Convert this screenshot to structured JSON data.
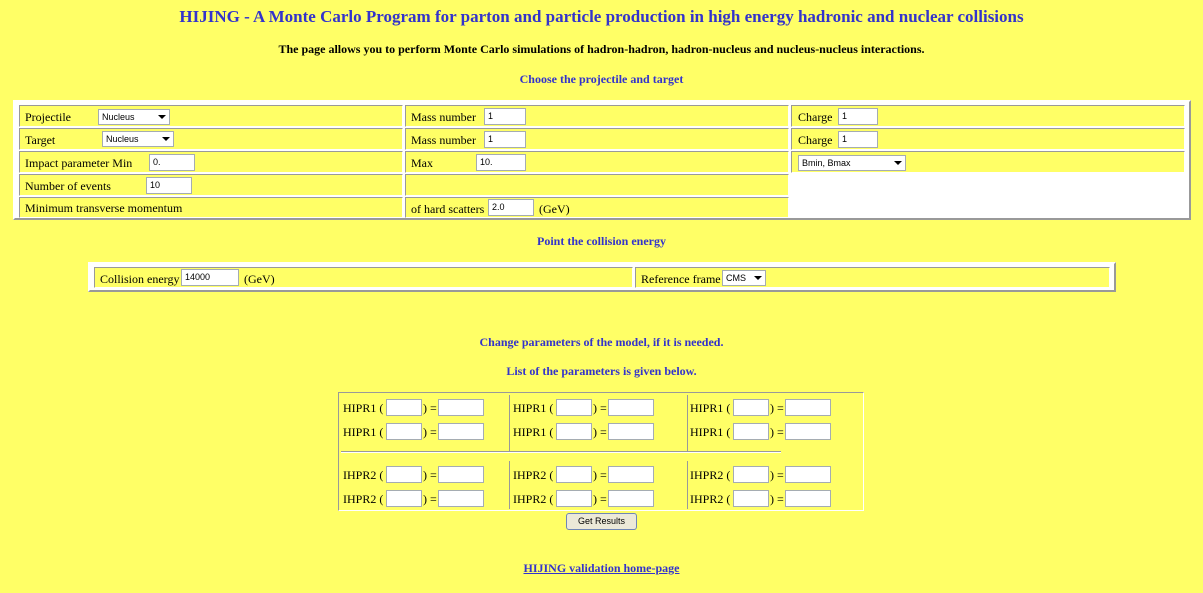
{
  "header": {
    "title": "HIJING - A Monte Carlo Program for parton and particle production in high energy hadronic and nuclear collisions",
    "subtitle": "The page allows you to perform Monte Carlo simulations of  hadron-hadron, hadron-nucleus and nucleus-nucleus interactions.",
    "choose_heading": "Choose the projectile and target",
    "energy_heading": "Point the collision energy",
    "params_heading": "Change parameters of the model, if it is needed.",
    "params_list_heading": "List of the parameters is given below."
  },
  "projectile_form": {
    "projectile_label": "Projectile",
    "projectile_value": "Nucleus",
    "proj_mass_label": "Mass number",
    "proj_mass_value": "1",
    "proj_charge_label": "Charge",
    "proj_charge_value": "1",
    "target_label": "Target",
    "target_value": "Nucleus",
    "targ_mass_label": "Mass number",
    "targ_mass_value": "1",
    "targ_charge_label": "Charge",
    "targ_charge_value": "1",
    "impact_min_label": "Impact parameter Min",
    "impact_min_value": "0.",
    "impact_max_label": "Max",
    "impact_max_value": "10.",
    "impact_mode_value": "Bmin, Bmax",
    "events_label": "Number of events",
    "events_value": "10",
    "ptmin_label": "Minimum transverse momentum",
    "hard_scatter_label": "of hard scatters",
    "hard_scatter_value": "2.0",
    "gev_unit": "(GeV)"
  },
  "energy_form": {
    "energy_label": "Collision energy",
    "energy_value": "14000",
    "energy_unit": "(GeV)",
    "frame_label": "Reference frame",
    "frame_value": "CMS"
  },
  "params": {
    "hipr_label": "HIPR1 (",
    "ihpr_label": "IHPR2 (",
    "equals": ") ="
  },
  "actions": {
    "submit_label": "Get Results"
  },
  "footer": {
    "home_link": "HIJING validation home-page"
  }
}
